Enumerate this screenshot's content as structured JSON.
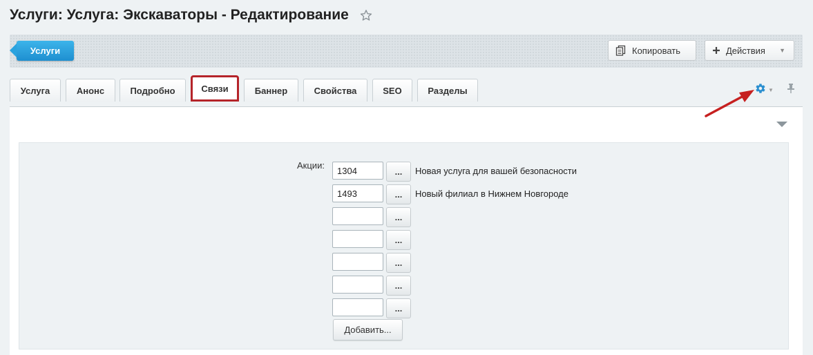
{
  "header": {
    "title": "Услуги: Услуга: Экскаваторы - Редактирование"
  },
  "toolbar": {
    "back_label": "Услуги",
    "copy_label": "Копировать",
    "actions_label": "Действия"
  },
  "tabs": [
    {
      "label": "Услуга"
    },
    {
      "label": "Анонс"
    },
    {
      "label": "Подробно"
    },
    {
      "label": "Связи",
      "active": true
    },
    {
      "label": "Баннер"
    },
    {
      "label": "Свойства"
    },
    {
      "label": "SEO"
    },
    {
      "label": "Разделы"
    }
  ],
  "form": {
    "field_label": "Акции:",
    "dots_label": "...",
    "rows": [
      {
        "value": "1304",
        "description": "Новая услуга для вашей безопасности"
      },
      {
        "value": "1493",
        "description": "Новый филиал в Нижнем Новгороде"
      },
      {
        "value": "",
        "description": ""
      },
      {
        "value": "",
        "description": ""
      },
      {
        "value": "",
        "description": ""
      },
      {
        "value": "",
        "description": ""
      },
      {
        "value": "",
        "description": ""
      }
    ],
    "add_label": "Добавить..."
  },
  "colors": {
    "back_button": "#1e8fd0",
    "highlight": "#b5242a",
    "annotation_arrow": "#c62020",
    "settings_icon": "#2b8fd0"
  },
  "icons": {
    "star": "star-icon",
    "copy": "copy-icon",
    "actions": "plus-icon",
    "settings": "gear-icon",
    "pin": "pin-icon",
    "collapse": "triangle-down-icon"
  }
}
